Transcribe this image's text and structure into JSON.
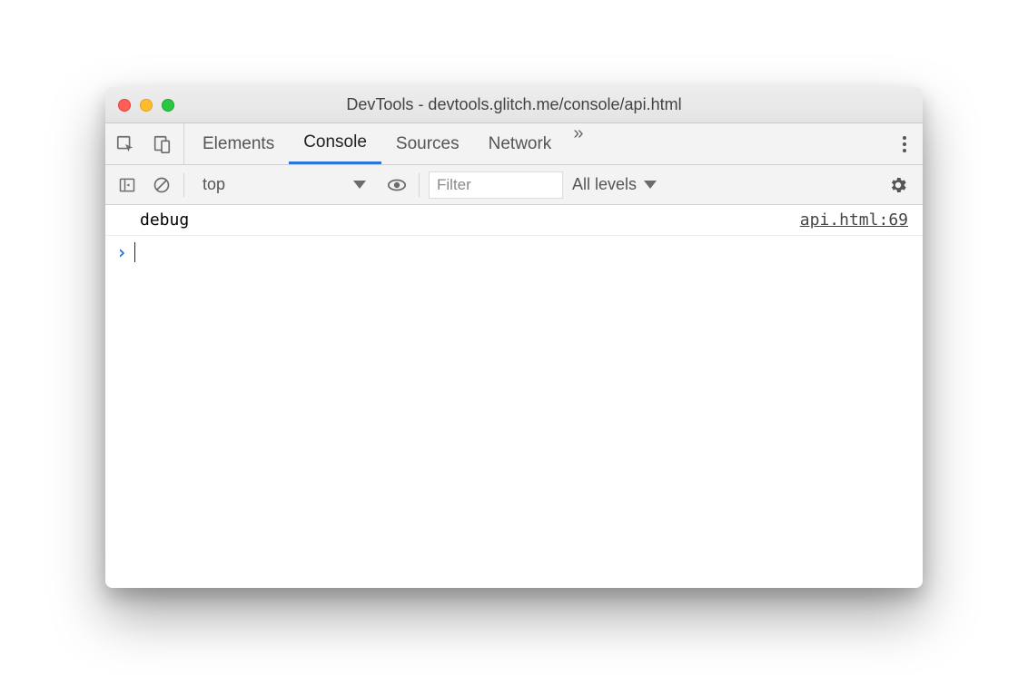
{
  "window": {
    "title": "DevTools - devtools.glitch.me/console/api.html"
  },
  "tabs": {
    "elements": "Elements",
    "console": "Console",
    "sources": "Sources",
    "network": "Network"
  },
  "toolbar": {
    "context": "top",
    "filter_placeholder": "Filter",
    "levels": "All levels"
  },
  "log": {
    "message": "debug",
    "source": "api.html:69"
  }
}
